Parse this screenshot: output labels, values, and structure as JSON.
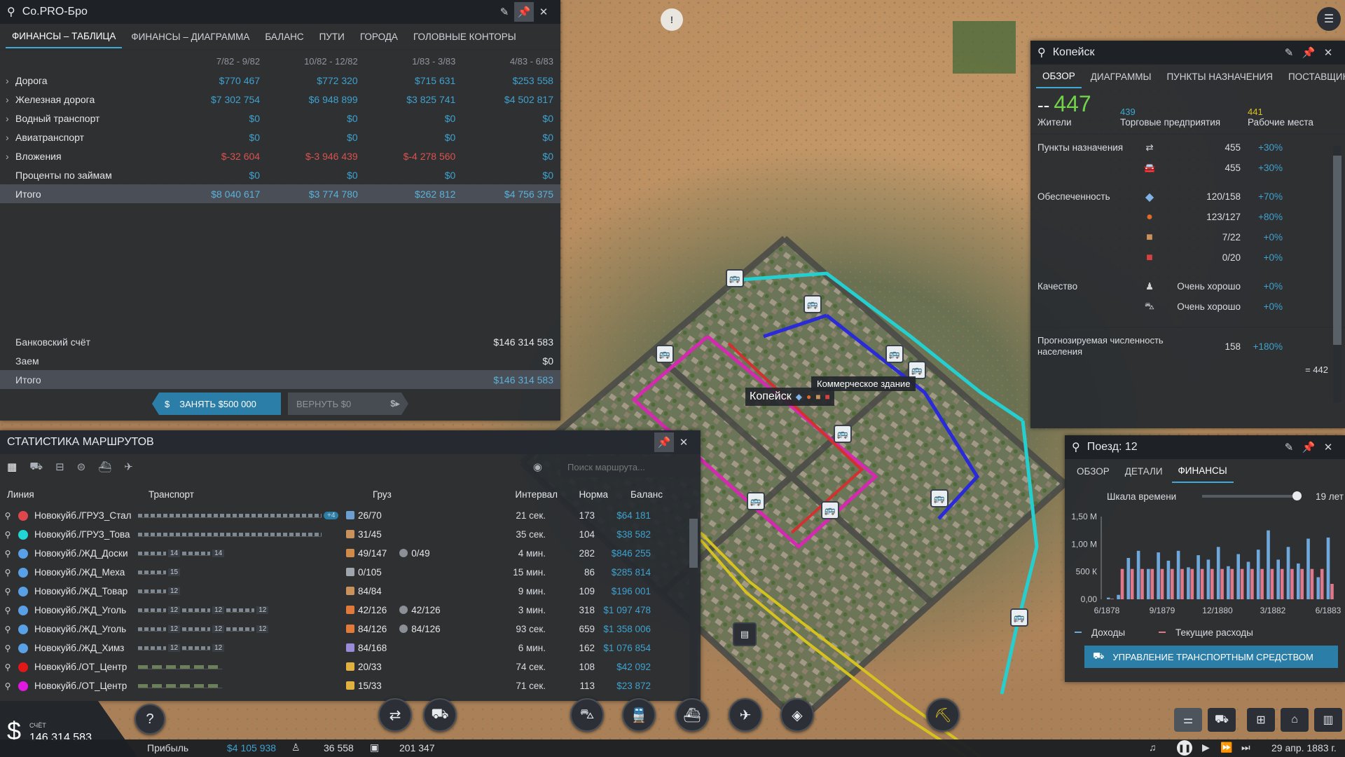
{
  "map": {
    "town_label": "Копейск",
    "tooltip": "Коммерческое здание"
  },
  "finance_panel": {
    "title": "Co.PRO-Бро",
    "tabs": [
      "ФИНАНСЫ – ТАБЛИЦА",
      "ФИНАНСЫ – ДИАГРАММА",
      "БАЛАНС",
      "ПУТИ",
      "ГОРОДА",
      "ГОЛОВНЫЕ КОНТОРЫ"
    ],
    "periods": [
      "7/82 - 9/82",
      "10/82 - 12/82",
      "1/83 - 3/83",
      "4/83 - 6/83"
    ],
    "rows": [
      {
        "label": "Дорога",
        "expand": true,
        "values": [
          "$770 467",
          "$772 320",
          "$715 631",
          "$253 558"
        ]
      },
      {
        "label": "Железная дорога",
        "expand": true,
        "values": [
          "$7 302 754",
          "$6 948 899",
          "$3 825 741",
          "$4 502 817"
        ]
      },
      {
        "label": "Водный транспорт",
        "expand": true,
        "values": [
          "$0",
          "$0",
          "$0",
          "$0"
        ]
      },
      {
        "label": "Авиатранспорт",
        "expand": true,
        "values": [
          "$0",
          "$0",
          "$0",
          "$0"
        ]
      },
      {
        "label": "Вложения",
        "expand": true,
        "values": [
          "$-32 604",
          "$-3 946 439",
          "$-4 278 560",
          "$0"
        ]
      },
      {
        "label": "Проценты по займам",
        "expand": false,
        "values": [
          "$0",
          "$0",
          "$0",
          "$0"
        ]
      }
    ],
    "total": {
      "label": "Итого",
      "values": [
        "$8 040 617",
        "$3 774 780",
        "$262 812",
        "$4 756 375"
      ]
    },
    "bank": {
      "label": "Банковский счёт",
      "value": "$146 314 583"
    },
    "loan": {
      "label": "Заем",
      "value": "$0"
    },
    "bank_total": {
      "label": "Итого",
      "value": "$146 314 583"
    },
    "borrow_label": "ЗАНЯТЬ $500 000",
    "repay_label": "ВЕРНУТЬ $0"
  },
  "route_panel": {
    "title": "СТАТИСТИКА МАРШРУТОВ",
    "search_placeholder": "Поиск маршрута...",
    "columns": {
      "line": "Линия",
      "transport": "Транспорт",
      "cargo": "Груз",
      "interval": "Интервал",
      "norm": "Норма",
      "balance": "Баланс"
    },
    "rows": [
      {
        "color": "#e0474c",
        "name": "Новокуйб./ГРУЗ_Стал",
        "transport": "trucks",
        "counts": [
          "+4"
        ],
        "cargo1": "26/70",
        "cargo1_color": "#6c9fd0",
        "cargo2": "",
        "interval": "21 сек.",
        "norm": "173",
        "balance": "$64 181"
      },
      {
        "color": "#22d4d4",
        "name": "Новокуйб./ГРУЗ_Това",
        "transport": "trucks",
        "counts": [],
        "cargo1": "31/45",
        "cargo1_color": "#c9925a",
        "cargo2": "",
        "interval": "35 сек.",
        "norm": "104",
        "balance": "$38 582"
      },
      {
        "color": "#5aa0e6",
        "name": "Новокуйб./ЖД_Доски",
        "transport": "trains",
        "counts": [
          "14",
          "14"
        ],
        "cargo1": "49/147",
        "cargo1_color": "#d08a4a",
        "cargo2": "0/49",
        "interval": "4 мин.",
        "norm": "282",
        "balance": "$846 255"
      },
      {
        "color": "#5aa0e6",
        "name": "Новокуйб./ЖД_Меха",
        "transport": "trains",
        "counts": [
          "15"
        ],
        "cargo1": "0/105",
        "cargo1_color": "#a0a6ad",
        "cargo2": "",
        "interval": "15 мин.",
        "norm": "86",
        "balance": "$285 814"
      },
      {
        "color": "#5aa0e6",
        "name": "Новокуйб./ЖД_Товар",
        "transport": "trains",
        "counts": [
          "12"
        ],
        "cargo1": "84/84",
        "cargo1_color": "#c9925a",
        "cargo2": "",
        "interval": "9 мин.",
        "norm": "109",
        "balance": "$196 001"
      },
      {
        "color": "#5aa0e6",
        "name": "Новокуйб./ЖД_Уголь",
        "transport": "trains",
        "counts": [
          "12",
          "12",
          "12"
        ],
        "cargo1": "42/126",
        "cargo1_color": "#e07a3a",
        "cargo2": "42/126",
        "interval": "3 мин.",
        "norm": "318",
        "balance": "$1 097 478"
      },
      {
        "color": "#5aa0e6",
        "name": "Новокуйб./ЖД_Уголь",
        "transport": "trains",
        "counts": [
          "12",
          "12",
          "12"
        ],
        "cargo1": "84/126",
        "cargo1_color": "#e07a3a",
        "cargo2": "84/126",
        "interval": "93 сек.",
        "norm": "659",
        "balance": "$1 358 006"
      },
      {
        "color": "#5aa0e6",
        "name": "Новокуйб./ЖД_Химз",
        "transport": "trains",
        "counts": [
          "12",
          "12"
        ],
        "cargo1": "84/168",
        "cargo1_color": "#9a8ad8",
        "cargo2": "",
        "interval": "6 мин.",
        "norm": "162",
        "balance": "$1 076 854"
      },
      {
        "color": "#e01818",
        "name": "Новокуйб./ОТ_Центр",
        "transport": "buses",
        "counts": [],
        "cargo1": "20/33",
        "cargo1_color": "#e0b040",
        "cargo2": "",
        "interval": "74 сек.",
        "norm": "108",
        "balance": "$42 092"
      },
      {
        "color": "#e018e0",
        "name": "Новокуйб./ОТ_Центр",
        "transport": "buses",
        "counts": [],
        "cargo1": "15/33",
        "cargo1_color": "#e0b040",
        "cargo2": "",
        "interval": "71 сек.",
        "norm": "113",
        "balance": "$23 872"
      }
    ]
  },
  "town_panel": {
    "title": "Копейск",
    "tabs": [
      "ОБЗОР",
      "ДИАГРАММЫ",
      "ПУНКТЫ НАЗНАЧЕНИЯ",
      "ПОСТАВЩИКИ"
    ],
    "residents_prefix": "--",
    "residents": "447",
    "residents_label": "Жители",
    "commercial": "439",
    "commercial_label": "Торговые предприятия",
    "jobs": "441",
    "jobs_label": "Рабочие места",
    "destinations_label": "Пункты назначения",
    "destinations": [
      {
        "icon": "⇄",
        "value": "455",
        "pct": "+30%"
      },
      {
        "icon": "🚘",
        "value": "455",
        "pct": "+30%"
      }
    ],
    "supply_label": "Обеспеченность",
    "supply": [
      {
        "icon_color": "#7fb3e6",
        "value": "120/158",
        "pct": "+70%"
      },
      {
        "icon_color": "#e06a2a",
        "value": "123/127",
        "pct": "+80%"
      },
      {
        "icon_color": "#c9925a",
        "value": "7/22",
        "pct": "+0%"
      },
      {
        "icon_color": "#d94040",
        "value": "0/20",
        "pct": "+0%"
      }
    ],
    "quality_label": "Качество",
    "quality": [
      {
        "value": "Очень хорошо",
        "pct": "+0%"
      },
      {
        "value": "Очень хорошо",
        "pct": "+0%"
      }
    ],
    "forecast_label": "Прогнозируемая численность населения",
    "forecast_value": "158",
    "forecast_pct": "+180%",
    "forecast_total": "= 442"
  },
  "train_panel": {
    "title": "Поезд: 12",
    "tabs": [
      "ОБЗОР",
      "ДЕТАЛИ",
      "ФИНАНСЫ"
    ],
    "timescale_label": "Шкала времени",
    "timescale_value": "19 лет",
    "y_ticks": [
      "1,50 М",
      "1,00 М",
      "500 К",
      "0,00"
    ],
    "x_ticks": [
      "6/1878",
      "9/1879",
      "12/1880",
      "3/1882",
      "6/1883"
    ],
    "legend_income": "Доходы",
    "legend_costs": "Текущие расходы",
    "manage_button": "УПРАВЛЕНИЕ ТРАНСПОРТНЫМ СРЕДСТВОМ"
  },
  "chart_data": {
    "type": "bar",
    "x": [
      "6/1878",
      "",
      "",
      "",
      "",
      "9/1879",
      "",
      "",
      "",
      "",
      "12/1880",
      "",
      "",
      "",
      "",
      "",
      "3/1882",
      "",
      "",
      "",
      "",
      "",
      "6/1883"
    ],
    "series": [
      {
        "name": "Доходы",
        "color": "#6fa8dc",
        "values": [
          0.03,
          0.08,
          0.75,
          0.88,
          0.55,
          0.85,
          0.7,
          0.88,
          0.58,
          0.8,
          0.72,
          0.95,
          0.6,
          0.82,
          0.68,
          0.9,
          1.25,
          0.72,
          0.95,
          0.65,
          1.1,
          0.4,
          1.12
        ]
      },
      {
        "name": "Текущие расходы",
        "color": "#e0788a",
        "values": [
          0.01,
          0.55,
          0.55,
          0.55,
          0.55,
          0.55,
          0.55,
          0.55,
          0.55,
          0.55,
          0.55,
          0.55,
          0.55,
          0.55,
          0.55,
          0.55,
          0.55,
          0.55,
          0.55,
          0.55,
          0.55,
          0.55,
          0.28
        ]
      }
    ],
    "ylim": [
      0,
      1.5
    ],
    "ylabel": "",
    "xlabel": ""
  },
  "bottom_bar": {
    "account_label": "СЧЁТ",
    "account_value": "146 314 583",
    "profit_label": "Прибыль",
    "profit_value": "$4 105 938",
    "passengers": "36 558",
    "cargo": "201 347",
    "date": "29 апр. 1883 г."
  }
}
